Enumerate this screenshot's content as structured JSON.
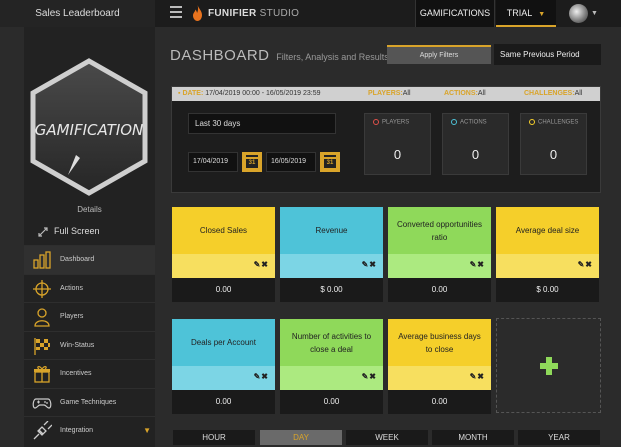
{
  "topbar": {
    "app_title": "Sales Leaderboard",
    "brand_name": "FUNIFIER",
    "brand_suffix": "STUDIO",
    "tabs": [
      {
        "label": "GAMIFICATIONS"
      },
      {
        "label": "TRIAL"
      }
    ],
    "accent_color": "#d9a42a"
  },
  "sidebar": {
    "logo_text": "GAMIFICATION",
    "details_label": "Details",
    "fullscreen_label": "Full Screen",
    "items": [
      {
        "label": "Dashboard",
        "icon": "bar-chart-icon"
      },
      {
        "label": "Actions",
        "icon": "target-icon"
      },
      {
        "label": "Players",
        "icon": "user-icon"
      },
      {
        "label": "Win-Status",
        "icon": "checkered-flag-icon"
      },
      {
        "label": "Incentives",
        "icon": "gift-icon"
      },
      {
        "label": "Game Techniques",
        "icon": "gamepad-icon"
      },
      {
        "label": "Integration",
        "icon": "plug-icon"
      }
    ]
  },
  "dashboard": {
    "title": "DASHBOARD",
    "subtitle": "Filters, Analysis and Results",
    "apply_filters_label": "Apply Filters",
    "period_compare_value": "Same Previous Period"
  },
  "filter_panel": {
    "date_label": "DATE:",
    "date_range": "17/04/2019 00:00 - 16/05/2019 23:59",
    "players_label": "PLAYERS:",
    "players_value": "All",
    "actions_label": "ACTIONS:",
    "actions_value": "All",
    "challenges_label": "CHALLENGES:",
    "challenges_value": "All",
    "range_select_value": "Last 30 days",
    "date_from": "17/04/2019",
    "date_to": "16/05/2019",
    "calendar_day": "31",
    "counters": [
      {
        "label": "PLAYERS",
        "value": "0",
        "color": "#e0504a"
      },
      {
        "label": "ACTIONS",
        "value": "0",
        "color": "#4ec3d8"
      },
      {
        "label": "CHALLENGES",
        "value": "0",
        "color": "#f5cf2a"
      }
    ]
  },
  "cards": [
    {
      "title": "Closed Sales",
      "value": "0.00",
      "color": "yellow"
    },
    {
      "title": "Revenue",
      "value": "$ 0.00",
      "color": "cyan"
    },
    {
      "title": "Converted opportunities ratio",
      "value": "0.00",
      "color": "green"
    },
    {
      "title": "Average deal size",
      "value": "$ 0.00",
      "color": "yellow"
    },
    {
      "title": "Deals per Account",
      "value": "0.00",
      "color": "cyan"
    },
    {
      "title": "Number of activities to close a deal",
      "value": "0.00",
      "color": "green"
    },
    {
      "title": "Average business days to close",
      "value": "0.00",
      "color": "yellow"
    }
  ],
  "period_tabs": [
    {
      "label": "HOUR"
    },
    {
      "label": "DAY"
    },
    {
      "label": "WEEK"
    },
    {
      "label": "MONTH"
    },
    {
      "label": "YEAR"
    }
  ]
}
